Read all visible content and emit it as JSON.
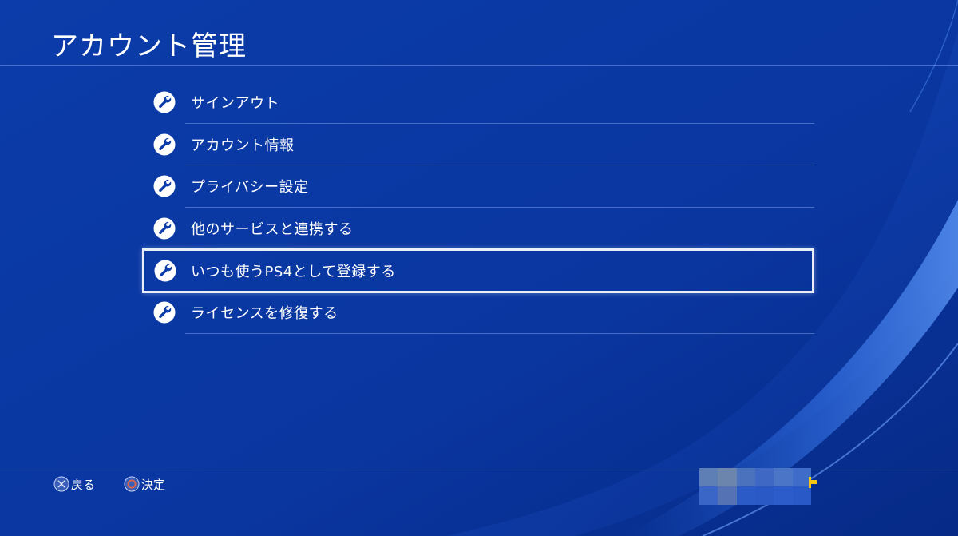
{
  "header": {
    "title": "アカウント管理"
  },
  "menu": {
    "items": [
      {
        "label": "サインアウト",
        "icon": "wrench-icon",
        "selected": false
      },
      {
        "label": "アカウント情報",
        "icon": "wrench-icon",
        "selected": false
      },
      {
        "label": "プライバシー設定",
        "icon": "wrench-icon",
        "selected": false
      },
      {
        "label": "他のサービスと連携する",
        "icon": "wrench-icon",
        "selected": false
      },
      {
        "label": "いつも使うPS4として登録する",
        "icon": "wrench-icon",
        "selected": true
      },
      {
        "label": "ライセンスを修復する",
        "icon": "wrench-icon",
        "selected": false
      }
    ]
  },
  "footer": {
    "back": {
      "icon": "cross-button-icon",
      "label": "戻る"
    },
    "confirm": {
      "icon": "circle-button-icon",
      "label": "決定"
    },
    "user": {
      "pixelated": true,
      "indicator_color": "#f5c518"
    }
  },
  "colors": {
    "background": "#0a3aa8",
    "accent_wave": "#2f6fe0",
    "text": "#ffffff",
    "selection_border": "#e9eef8",
    "circle_button": "#e0644a"
  }
}
